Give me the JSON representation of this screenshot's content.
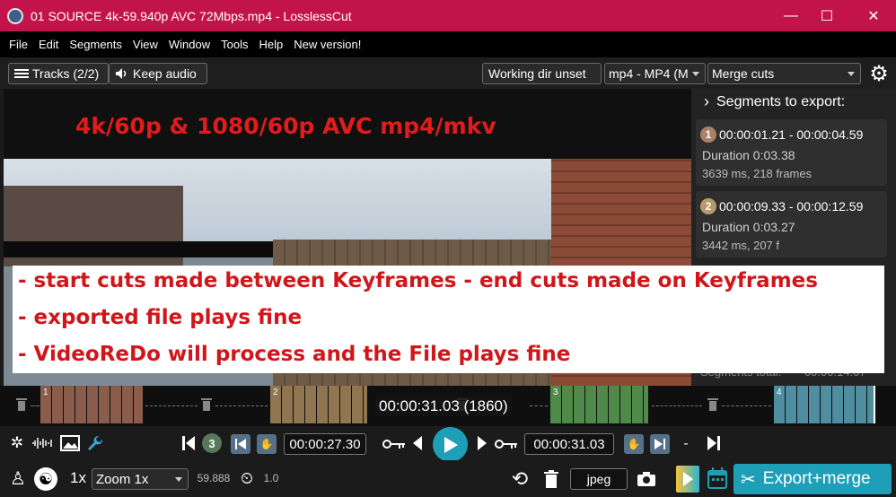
{
  "window": {
    "title": "01 SOURCE 4k-59.940p AVC 72Mbps.mp4 - LosslessCut",
    "controls": [
      "—",
      "☐",
      "✕"
    ]
  },
  "menu": [
    "File",
    "Edit",
    "Segments",
    "View",
    "Window",
    "Tools",
    "Help",
    "New version!"
  ],
  "toolbar": {
    "tracks_label": "Tracks (2/2)",
    "keep_audio_label": "Keep audio",
    "working_dir_label": "Working dir unset",
    "format_value": "mp4 - MP4 (M",
    "merge_value": "Merge cuts"
  },
  "video": {
    "heading": "4k/60p & 1080/60p AVC mp4/mkv",
    "annotation_lines": [
      "- start cuts made between Keyframes - end cuts made on Keyframes",
      "- exported file plays fine",
      "- VideoReDo will process and the File plays fine"
    ]
  },
  "segments_panel": {
    "header": "Segments to export:",
    "segments": [
      {
        "number": "1",
        "range": "00:00:01.21 - 00:00:04.59",
        "duration": "Duration 0:03.38",
        "info": "3639 ms, 218 frames",
        "color": "#a88066"
      },
      {
        "number": "2",
        "range": "00:00:09.33 - 00:00:12.59",
        "duration": "Duration 0:03.27",
        "info": "3442 ms, 207 f",
        "color": "#b89a6a"
      }
    ],
    "total_label": "Segments total:",
    "total_value": "00:00:14.07"
  },
  "timeline": {
    "current_time": "00:00:31.03 (1860)",
    "segment_labels": [
      "1",
      "2",
      "3",
      "4"
    ],
    "segment_colors": [
      "#8a5c4c",
      "#8f7550",
      "#4f8a4a",
      "#4f8ea0"
    ]
  },
  "controls": {
    "segment_count": "3",
    "cut_start_time": "00:00:27.30",
    "cut_end_time": "00:00:31.03",
    "dash": "-"
  },
  "bottom": {
    "speed": "1x",
    "zoom_value": "Zoom 1x",
    "fps": "59.888",
    "volume": "1.0",
    "capture_format": "jpeg",
    "export_label": "Export+merge"
  }
}
